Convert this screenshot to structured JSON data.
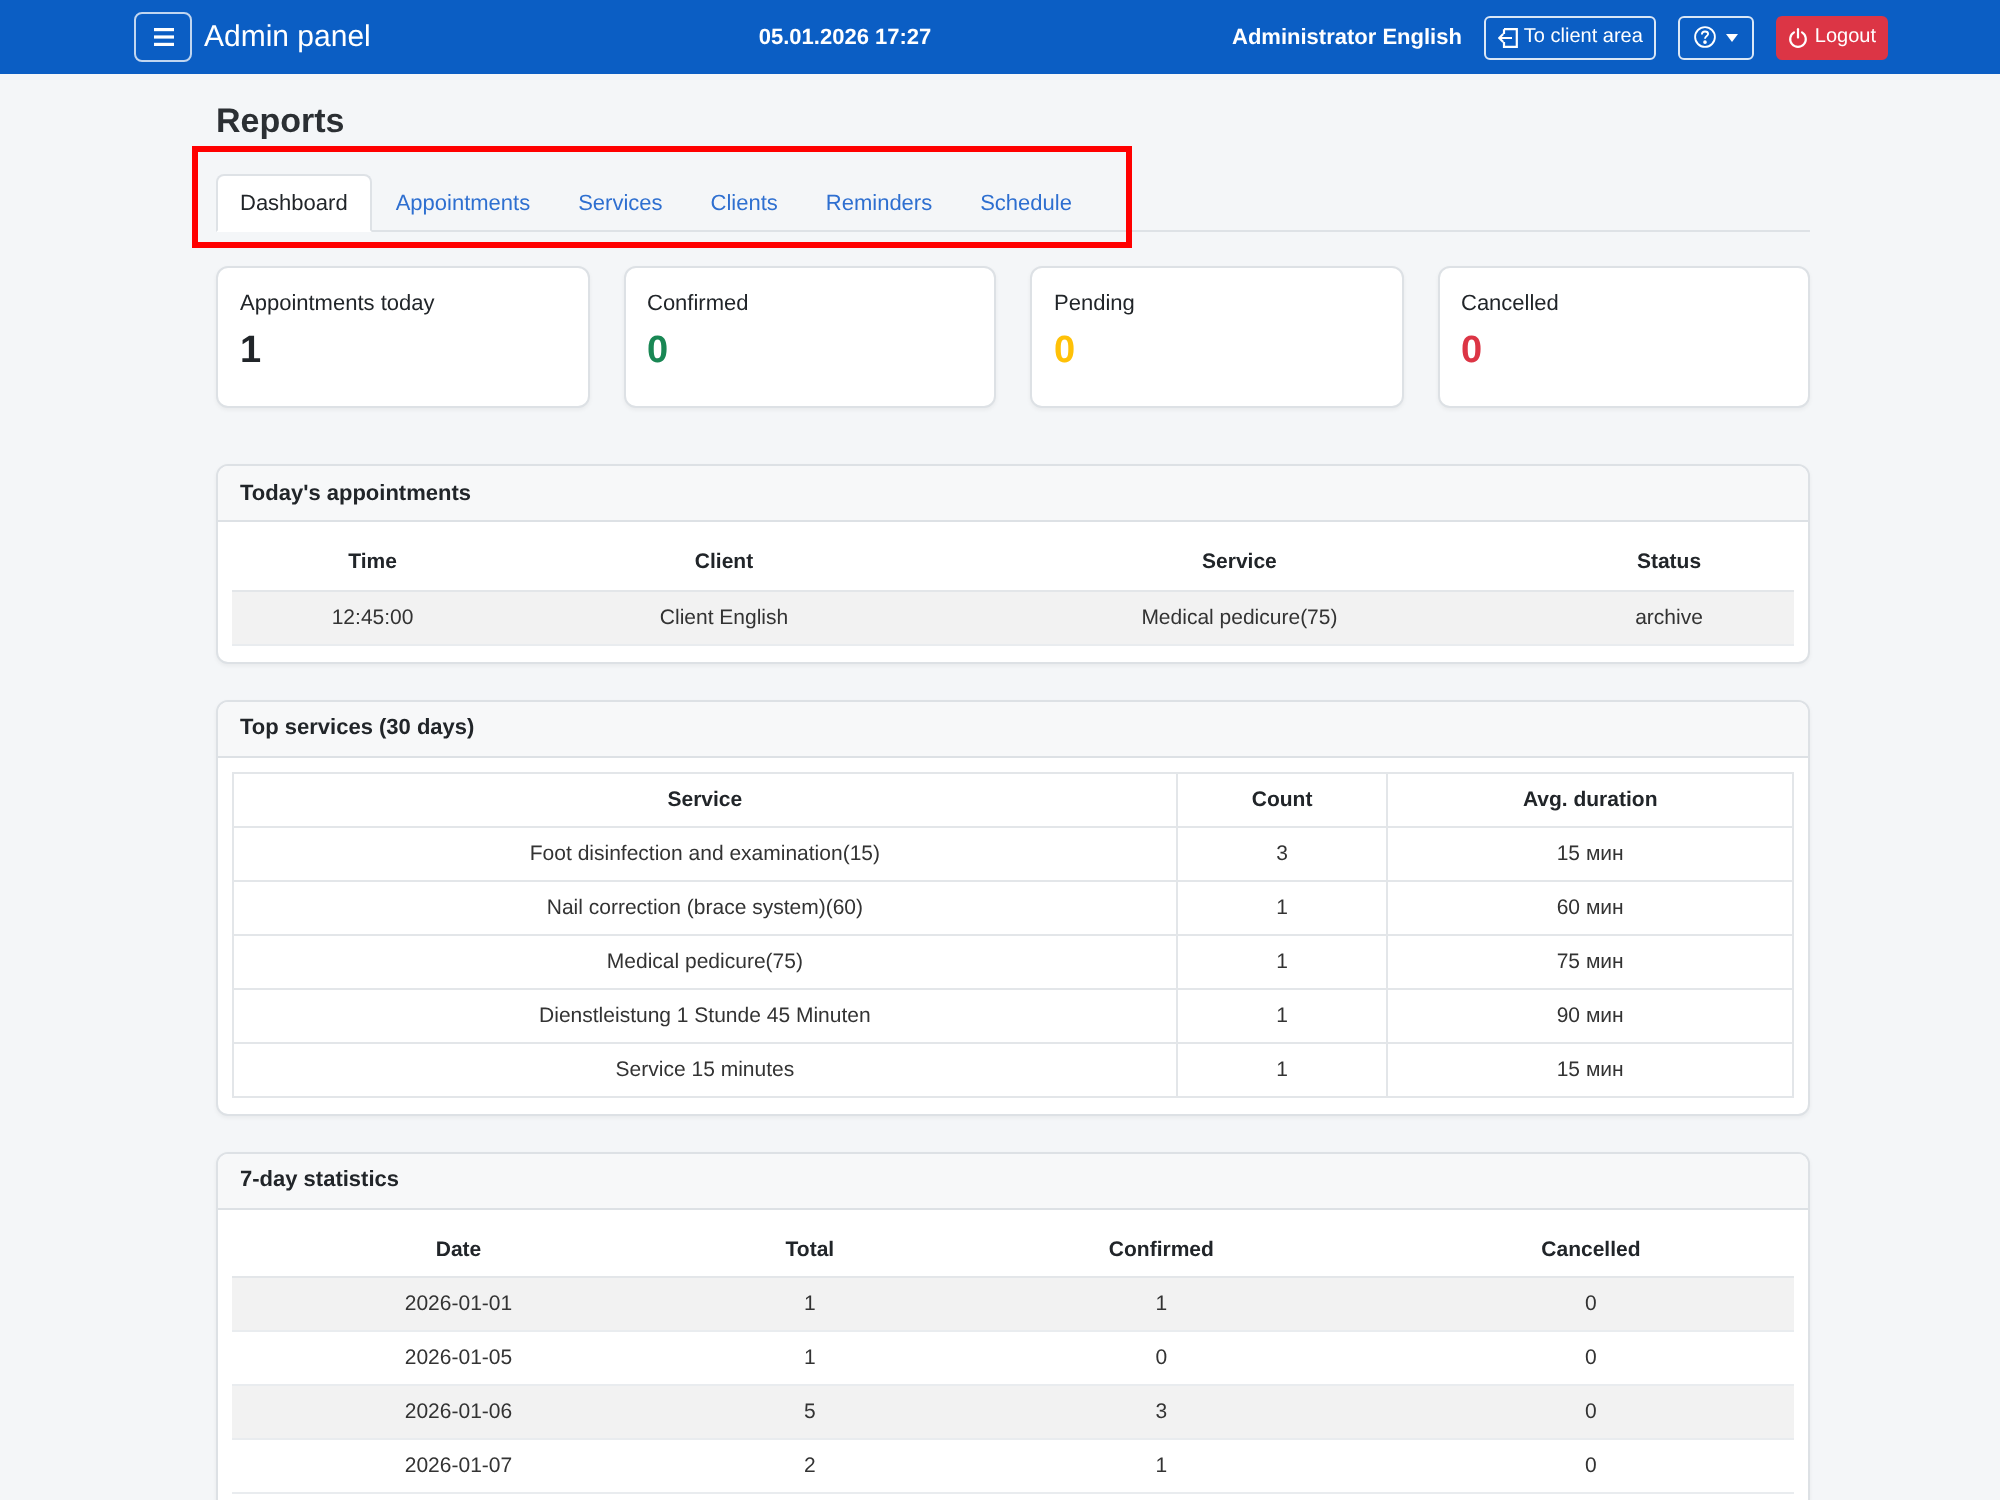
{
  "navbar": {
    "brand": "Admin panel",
    "datetime": "05.01.2026 17:27",
    "user": "Administrator English",
    "client_area_button": "To client area",
    "logout_button": "Logout"
  },
  "page_title": "Reports",
  "tabs": {
    "highlighted": true,
    "items": [
      {
        "label": "Dashboard",
        "selected": true
      },
      {
        "label": "Appointments",
        "selected": false
      },
      {
        "label": "Services",
        "selected": false
      },
      {
        "label": "Clients",
        "selected": false
      },
      {
        "label": "Reminders",
        "selected": false
      },
      {
        "label": "Schedule",
        "selected": false
      }
    ]
  },
  "stats": [
    {
      "label": "Appointments today",
      "value": "1",
      "color": "#212529"
    },
    {
      "label": "Confirmed",
      "value": "0",
      "color": "#198754"
    },
    {
      "label": "Pending",
      "value": "0",
      "color": "#ffc107"
    },
    {
      "label": "Cancelled",
      "value": "0",
      "color": "#dc3545"
    }
  ],
  "sections": [
    {
      "title": "Today's appointments",
      "kind": "striped",
      "columns": [
        "Time",
        "Client",
        "Service",
        "Status"
      ],
      "rows": [
        [
          "12:45:00",
          "Client English",
          "Medical pedicure(75)",
          "archive"
        ]
      ]
    },
    {
      "title": "Top services (30 days)",
      "kind": "bordered",
      "columns": [
        "Service",
        "Count",
        "Avg. duration"
      ],
      "rows": [
        [
          "Foot disinfection and examination(15)",
          "3",
          "15 мин"
        ],
        [
          "Nail correction (brace system)(60)",
          "1",
          "60 мин"
        ],
        [
          "Medical pedicure(75)",
          "1",
          "75 мин"
        ],
        [
          "Dienstleistung 1 Stunde 45 Minuten",
          "1",
          "90 мин"
        ],
        [
          "Service 15 minutes",
          "1",
          "15 мин"
        ]
      ]
    },
    {
      "title": "7-day statistics",
      "kind": "striped",
      "columns": [
        "Date",
        "Total",
        "Confirmed",
        "Cancelled"
      ],
      "rows": [
        [
          "2026-01-01",
          "1",
          "1",
          "0"
        ],
        [
          "2026-01-05",
          "1",
          "0",
          "0"
        ],
        [
          "2026-01-06",
          "5",
          "3",
          "0"
        ],
        [
          "2026-01-07",
          "2",
          "1",
          "0"
        ]
      ]
    }
  ]
}
